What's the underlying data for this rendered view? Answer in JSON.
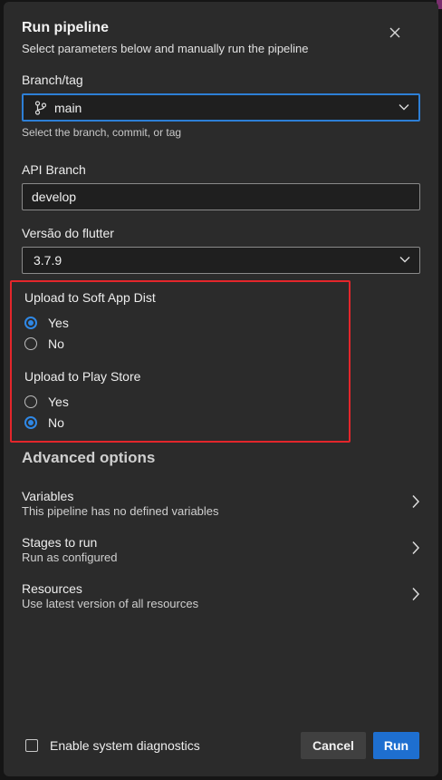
{
  "dialog": {
    "title": "Run pipeline",
    "subtitle": "Select parameters below and manually run the pipeline"
  },
  "branch": {
    "label": "Branch/tag",
    "value": "main",
    "help": "Select the branch, commit, or tag",
    "icon": "git-branch-icon"
  },
  "api_branch": {
    "label": "API Branch",
    "value": "develop"
  },
  "flutter": {
    "label": "Versão do flutter",
    "value": "3.7.9"
  },
  "soft_app_dist": {
    "label": "Upload to Soft App Dist",
    "options": [
      "Yes",
      "No"
    ],
    "selected": "Yes"
  },
  "play_store": {
    "label": "Upload to Play Store",
    "options": [
      "Yes",
      "No"
    ],
    "selected": "No"
  },
  "advanced": {
    "title": "Advanced options",
    "items": [
      {
        "title": "Variables",
        "subtitle": "This pipeline has no defined variables"
      },
      {
        "title": "Stages to run",
        "subtitle": "Run as configured"
      },
      {
        "title": "Resources",
        "subtitle": "Use latest version of all resources"
      }
    ]
  },
  "footer": {
    "diagnostics_label": "Enable system diagnostics",
    "diagnostics_checked": false,
    "cancel_label": "Cancel",
    "run_label": "Run"
  },
  "colors": {
    "panel_bg": "#2b2b2b",
    "accent_blue": "#2f88e6",
    "run_button": "#1e6fd0",
    "highlight_border": "#e3262b"
  }
}
